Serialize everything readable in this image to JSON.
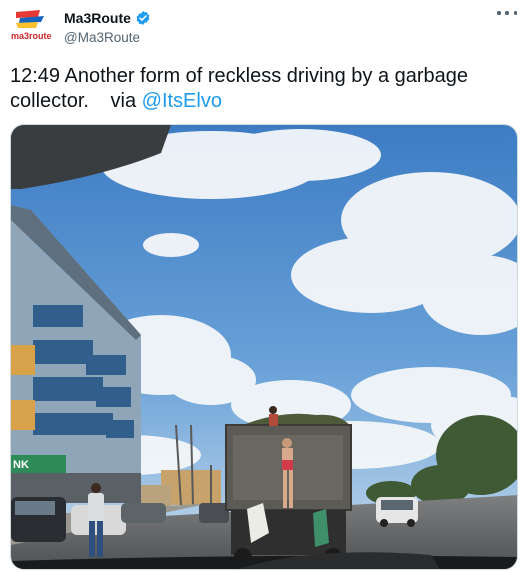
{
  "account": {
    "display_name": "Ma3Route",
    "handle": "@Ma3Route",
    "avatar_text": "ma3route",
    "verified": true,
    "avatar_colors": [
      "#e53935",
      "#1565c0",
      "#fbc02d"
    ]
  },
  "tweet": {
    "text": "12:49 Another form of reckless driving by a garbage collector.",
    "via_label": "via",
    "mention": "@ItsElvo"
  },
  "media": {
    "description_icon": "photo",
    "sign_text": "NK"
  },
  "icons": {
    "more": "more-horizontal-icon",
    "verified": "verified-badge-icon"
  },
  "colors": {
    "link": "#1d9bf0",
    "secondary_text": "#536471",
    "verified_badge": "#1d9bf0"
  }
}
